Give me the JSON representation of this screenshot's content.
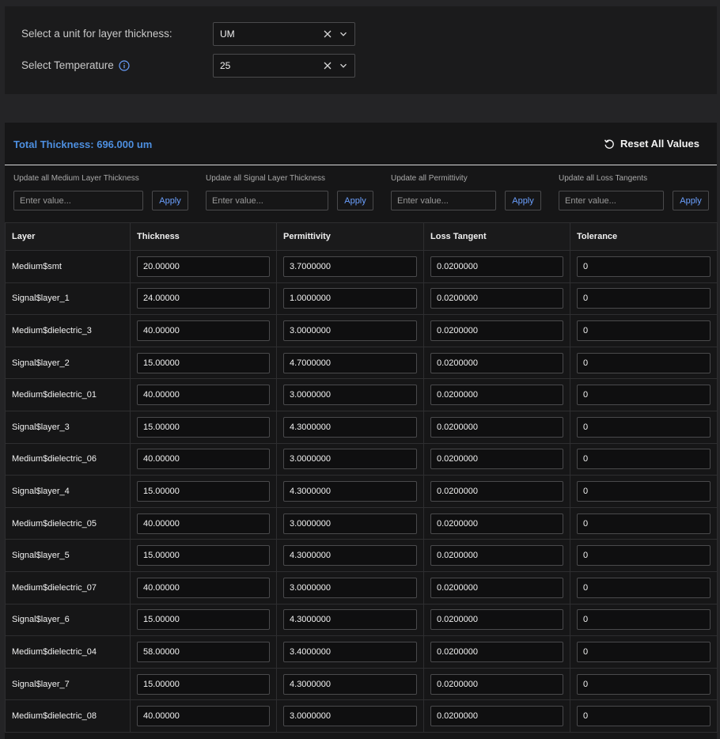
{
  "settings": {
    "unit": {
      "label": "Select a unit for layer thickness:",
      "value": "UM"
    },
    "temperature": {
      "label": "Select Temperature",
      "value": "25"
    }
  },
  "summary": {
    "total_thickness": "Total Thickness: 696.000 um",
    "reset_label": "Reset All Values"
  },
  "bulk_update": [
    {
      "label": "Update all Medium Layer Thickness",
      "placeholder": "Enter value...",
      "apply": "Apply"
    },
    {
      "label": "Update all Signal Layer Thickness",
      "placeholder": "Enter value...",
      "apply": "Apply"
    },
    {
      "label": "Update all Permittivity",
      "placeholder": "Enter value...",
      "apply": "Apply"
    },
    {
      "label": "Update all Loss Tangents",
      "placeholder": "Enter value...",
      "apply": "Apply"
    }
  ],
  "table": {
    "columns": [
      "Layer",
      "Thickness",
      "Permittivity",
      "Loss Tangent",
      "Tolerance"
    ],
    "rows": [
      {
        "layer": "Medium$smt",
        "thickness": "20.00000",
        "permittivity": "3.7000000",
        "loss_tangent": "0.0200000",
        "tolerance": "0"
      },
      {
        "layer": "Signal$layer_1",
        "thickness": "24.00000",
        "permittivity": "1.0000000",
        "loss_tangent": "0.0200000",
        "tolerance": "0"
      },
      {
        "layer": "Medium$dielectric_3",
        "thickness": "40.00000",
        "permittivity": "3.0000000",
        "loss_tangent": "0.0200000",
        "tolerance": "0"
      },
      {
        "layer": "Signal$layer_2",
        "thickness": "15.00000",
        "permittivity": "4.7000000",
        "loss_tangent": "0.0200000",
        "tolerance": "0"
      },
      {
        "layer": "Medium$dielectric_01",
        "thickness": "40.00000",
        "permittivity": "3.0000000",
        "loss_tangent": "0.0200000",
        "tolerance": "0"
      },
      {
        "layer": "Signal$layer_3",
        "thickness": "15.00000",
        "permittivity": "4.3000000",
        "loss_tangent": "0.0200000",
        "tolerance": "0"
      },
      {
        "layer": "Medium$dielectric_06",
        "thickness": "40.00000",
        "permittivity": "3.0000000",
        "loss_tangent": "0.0200000",
        "tolerance": "0"
      },
      {
        "layer": "Signal$layer_4",
        "thickness": "15.00000",
        "permittivity": "4.3000000",
        "loss_tangent": "0.0200000",
        "tolerance": "0"
      },
      {
        "layer": "Medium$dielectric_05",
        "thickness": "40.00000",
        "permittivity": "3.0000000",
        "loss_tangent": "0.0200000",
        "tolerance": "0"
      },
      {
        "layer": "Signal$layer_5",
        "thickness": "15.00000",
        "permittivity": "4.3000000",
        "loss_tangent": "0.0200000",
        "tolerance": "0"
      },
      {
        "layer": "Medium$dielectric_07",
        "thickness": "40.00000",
        "permittivity": "3.0000000",
        "loss_tangent": "0.0200000",
        "tolerance": "0"
      },
      {
        "layer": "Signal$layer_6",
        "thickness": "15.00000",
        "permittivity": "4.3000000",
        "loss_tangent": "0.0200000",
        "tolerance": "0"
      },
      {
        "layer": "Medium$dielectric_04",
        "thickness": "58.00000",
        "permittivity": "3.4000000",
        "loss_tangent": "0.0200000",
        "tolerance": "0"
      },
      {
        "layer": "Signal$layer_7",
        "thickness": "15.00000",
        "permittivity": "4.3000000",
        "loss_tangent": "0.0200000",
        "tolerance": "0"
      },
      {
        "layer": "Medium$dielectric_08",
        "thickness": "40.00000",
        "permittivity": "3.0000000",
        "loss_tangent": "0.0200000",
        "tolerance": "0"
      }
    ]
  },
  "colors": {
    "accent": "#4d8fe0",
    "apply_text": "#6ba0ff",
    "panel_bg": "#161617",
    "page_bg": "#242426"
  }
}
